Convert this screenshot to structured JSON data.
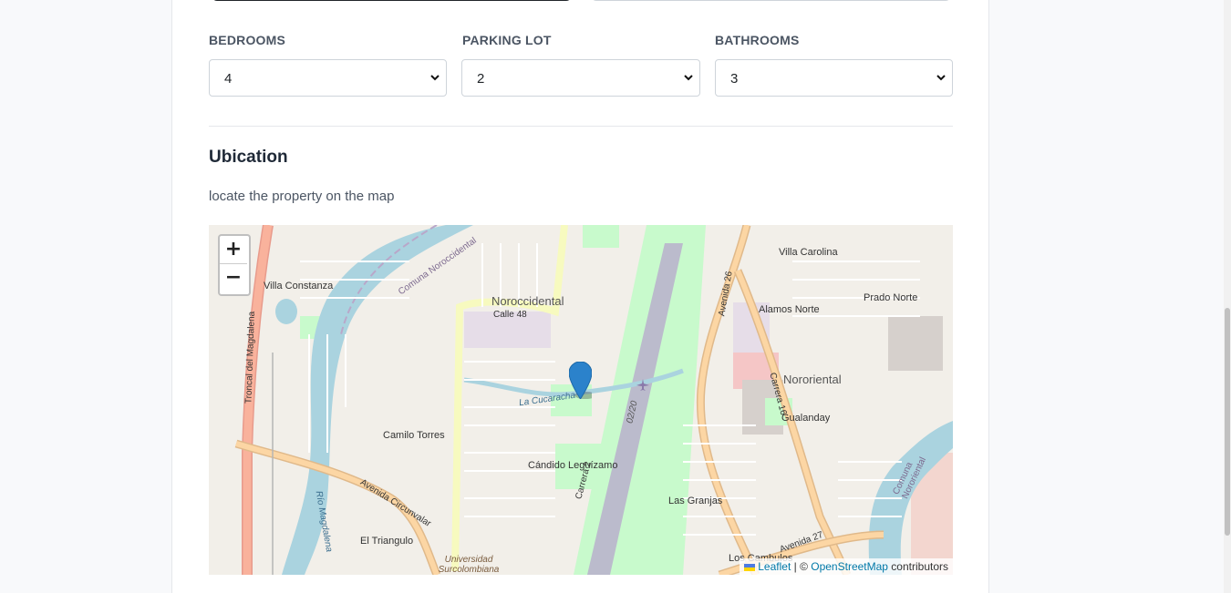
{
  "fields": {
    "bedrooms": {
      "label": "BEDROOMS",
      "value": "4"
    },
    "parking": {
      "label": "PARKING LOT",
      "value": "2"
    },
    "bathrooms": {
      "label": "BATHROOMS",
      "value": "3"
    }
  },
  "location": {
    "title": "Ubication",
    "subtitle": "locate the property on the map"
  },
  "map": {
    "zoom_in": "+",
    "zoom_out": "−",
    "attribution": {
      "leaflet": "Leaflet",
      "separator": " | © ",
      "osm": "OpenStreetMap",
      "suffix": " contributors"
    },
    "labels": {
      "l1": "Noroccidental",
      "l2": "Nororiental",
      "l3": "Villa Constanza",
      "l4": "Villa Carolina",
      "l5": "Alamos Norte",
      "l6": "Prado Norte",
      "l7": "Gualanday",
      "l8": "Camilo Torres",
      "l9": "Cándido Leguízamo",
      "l10": "Las Granjas",
      "l11": "El Triangulo",
      "l12": "Los Cambulos",
      "l13": "Troncal del Magdalena",
      "l14": "Avenida Circunvalar",
      "l15": "Calle 48",
      "l16": "Carrera 2",
      "l17": "Avenida 26",
      "l18": "Carrera 16",
      "l19": "Avenida 27",
      "l20": "Río Magdalena",
      "l21": "Comuna Noroccidental",
      "l22": "Comuna Nororiental",
      "l23": "La Cucaracha",
      "l24": "Universidad Surcolombiana",
      "l25": "02/20"
    },
    "colors": {
      "land": "#f2efe9",
      "water": "#aad3df",
      "park": "#c8facc",
      "runway": "#bbbbcc",
      "major_road": "#fcd6a4",
      "trunk": "#f9b29c",
      "secondary": "#f7fabf"
    }
  }
}
